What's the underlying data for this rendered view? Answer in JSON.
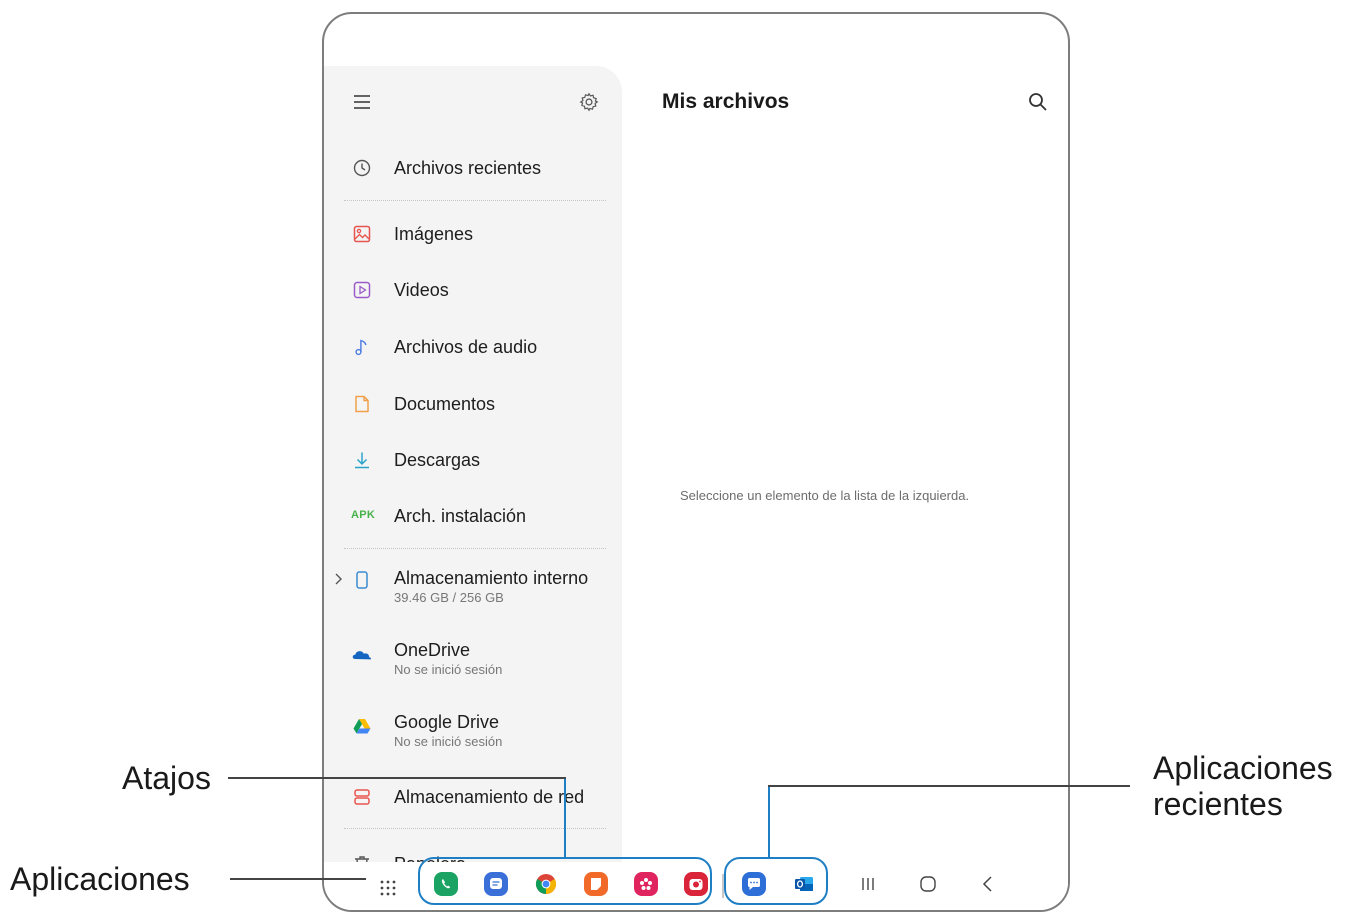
{
  "drawer": {
    "items": [
      {
        "label": "Archivos recientes",
        "icon": "clock-icon"
      },
      {
        "label": "Imágenes",
        "icon": "image-icon"
      },
      {
        "label": "Videos",
        "icon": "video-icon"
      },
      {
        "label": "Archivos de audio",
        "icon": "music-note-icon"
      },
      {
        "label": "Documentos",
        "icon": "document-icon"
      },
      {
        "label": "Descargas",
        "icon": "download-icon"
      },
      {
        "label": "Arch. instalación",
        "icon": "apk-icon",
        "icon_text": "APK"
      },
      {
        "label": "Almacenamiento interno",
        "sub": "39.46 GB / 256 GB",
        "icon": "phone-storage-icon"
      },
      {
        "label": "OneDrive",
        "sub": "No se inició sesión",
        "icon": "onedrive-icon"
      },
      {
        "label": "Google Drive",
        "sub": "No se inició sesión",
        "icon": "google-drive-icon"
      },
      {
        "label": "Almacenamiento de red",
        "icon": "network-storage-icon"
      },
      {
        "label": "Papelera",
        "icon": "trash-icon"
      }
    ]
  },
  "main": {
    "title": "Mis archivos",
    "placeholder": "Seleccione un elemento de la lista de la izquierda."
  },
  "taskbar": {
    "shortcuts": [
      "phone-app-icon",
      "messages-app-icon",
      "chrome-app-icon",
      "notes-app-icon",
      "flower-app-icon",
      "camera-app-icon"
    ],
    "recent": [
      "chat-app-icon",
      "outlook-app-icon"
    ],
    "nav": [
      "recents-button",
      "home-button",
      "back-button"
    ]
  },
  "callouts": {
    "shortcuts": "Atajos",
    "apps": "Aplicaciones",
    "recent_line1": "Aplicaciones",
    "recent_line2": "recientes"
  },
  "colors": {
    "accent": "#1f7fc4",
    "drawer_bg": "#f4f4f4",
    "apk": "#48b24a"
  }
}
